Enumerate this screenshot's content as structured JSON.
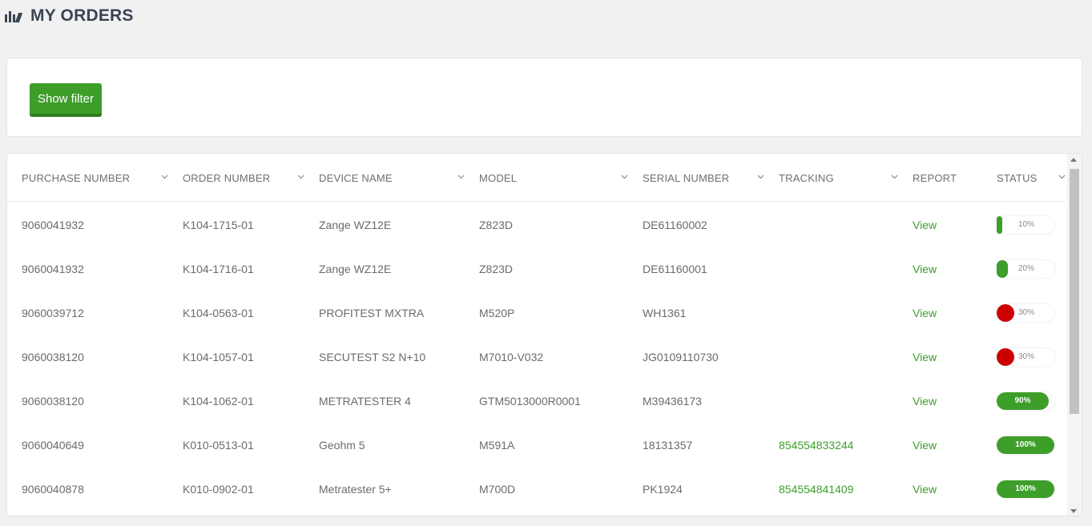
{
  "header": {
    "title": "MY ORDERS",
    "logo_icon": "logo-icon"
  },
  "filter": {
    "show_filter_label": "Show filter"
  },
  "table": {
    "columns": [
      {
        "label": "PURCHASE NUMBER",
        "sortable": true
      },
      {
        "label": "ORDER NUMBER",
        "sortable": true
      },
      {
        "label": "DEVICE NAME",
        "sortable": true
      },
      {
        "label": "MODEL",
        "sortable": true
      },
      {
        "label": "SERIAL NUMBER",
        "sortable": true
      },
      {
        "label": "TRACKING",
        "sortable": true
      },
      {
        "label": "REPORT",
        "sortable": false
      },
      {
        "label": "STATUS",
        "sortable": true
      }
    ],
    "rows": [
      {
        "purchase": "9060041932",
        "order": "K104-1715-01",
        "device": "Zange WZ12E",
        "model": "Z823D",
        "serial": "DE61160002",
        "tracking": "",
        "report": "View",
        "status": {
          "value": 10,
          "label": "10%",
          "color": "#3d9e2a"
        }
      },
      {
        "purchase": "9060041932",
        "order": "K104-1716-01",
        "device": "Zange WZ12E",
        "model": "Z823D",
        "serial": "DE61160001",
        "tracking": "",
        "report": "View",
        "status": {
          "value": 20,
          "label": "20%",
          "color": "#3d9e2a"
        }
      },
      {
        "purchase": "9060039712",
        "order": "K104-0563-01",
        "device": "PROFITEST MXTRA",
        "model": "M520P",
        "serial": "WH1361",
        "tracking": "",
        "report": "View",
        "status": {
          "value": 30,
          "label": "30%",
          "color": "#cc0000"
        }
      },
      {
        "purchase": "9060038120",
        "order": "K104-1057-01",
        "device": "SECUTEST S2 N+10",
        "model": "M7010-V032",
        "serial": "JG0109110730",
        "tracking": "",
        "report": "View",
        "status": {
          "value": 30,
          "label": "30%",
          "color": "#cc0000"
        }
      },
      {
        "purchase": "9060038120",
        "order": "K104-1062-01",
        "device": "METRATESTER 4",
        "model": "GTM5013000R0001",
        "serial": "M39436173",
        "tracking": "",
        "report": "View",
        "status": {
          "value": 90,
          "label": "90%",
          "color": "#3d9e2a"
        }
      },
      {
        "purchase": "9060040649",
        "order": "K010-0513-01",
        "device": "Geohm 5",
        "model": "M591A",
        "serial": "18131357",
        "tracking": "854554833244",
        "report": "View",
        "status": {
          "value": 100,
          "label": "100%",
          "color": "#3d9e2a"
        }
      },
      {
        "purchase": "9060040878",
        "order": "K010-0902-01",
        "device": "Metratester 5+",
        "model": "M700D",
        "serial": "PK1924",
        "tracking": "854554841409",
        "report": "View",
        "status": {
          "value": 100,
          "label": "100%",
          "color": "#3d9e2a"
        }
      }
    ]
  }
}
